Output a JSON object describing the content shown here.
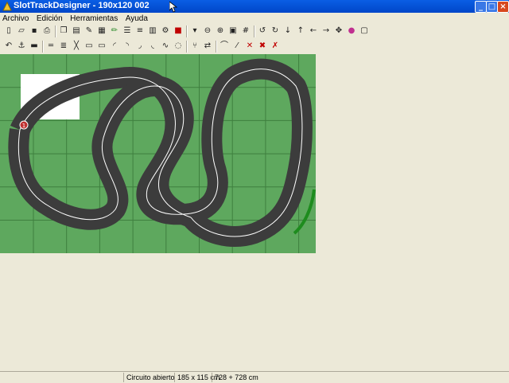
{
  "window": {
    "title": "SlotTrackDesigner - 190x120 002",
    "minimize": "_",
    "maximize": "□",
    "close": "×"
  },
  "menu": [
    "Archivo",
    "Edición",
    "Herramientas",
    "Ayuda"
  ],
  "toolbar1": {
    "icons": [
      "new-icon",
      "open-icon",
      "save-icon",
      "print-icon",
      "copy-icon",
      "doc-icon",
      "tools-icon",
      "page-icon",
      "pencil-icon",
      "list-icon",
      "layers-icon",
      "stack-icon",
      "settings-icon",
      "color-icon",
      "dropdown-icon",
      "zoom-out-icon",
      "zoom-in-icon",
      "zoom-fit-icon",
      "grid-icon",
      "rotate-left-icon",
      "rotate-right-icon",
      "arrow-down-icon",
      "arrow-up-icon",
      "arrow-left-icon",
      "arrow-right-icon",
      "move-icon",
      "palette-icon",
      "select-icon"
    ]
  },
  "toolbar2": {
    "icons": [
      "undo-icon",
      "anchor-icon",
      "barrier-icon",
      "straight-icon",
      "double-straight-icon",
      "crossover-icon",
      "pit-icon",
      "border-icon",
      "curve-icon",
      "curve2-icon",
      "curve3-icon",
      "curve4-icon",
      "chicane-icon",
      "loop-icon",
      "branch-icon",
      "lane-change-icon",
      "curve-small-icon",
      "ramp-icon",
      "delete-icon",
      "delete-all-icon",
      "delete-section-icon"
    ]
  },
  "board": {
    "grass_color": "#5ea85e",
    "track_color": "#3c3c3c",
    "start_label": "1"
  },
  "status": {
    "cell1": "",
    "cell2": "Circuito abierto",
    "cell3": "185 x 115 cm",
    "cell4": "728 + 728 cm"
  }
}
